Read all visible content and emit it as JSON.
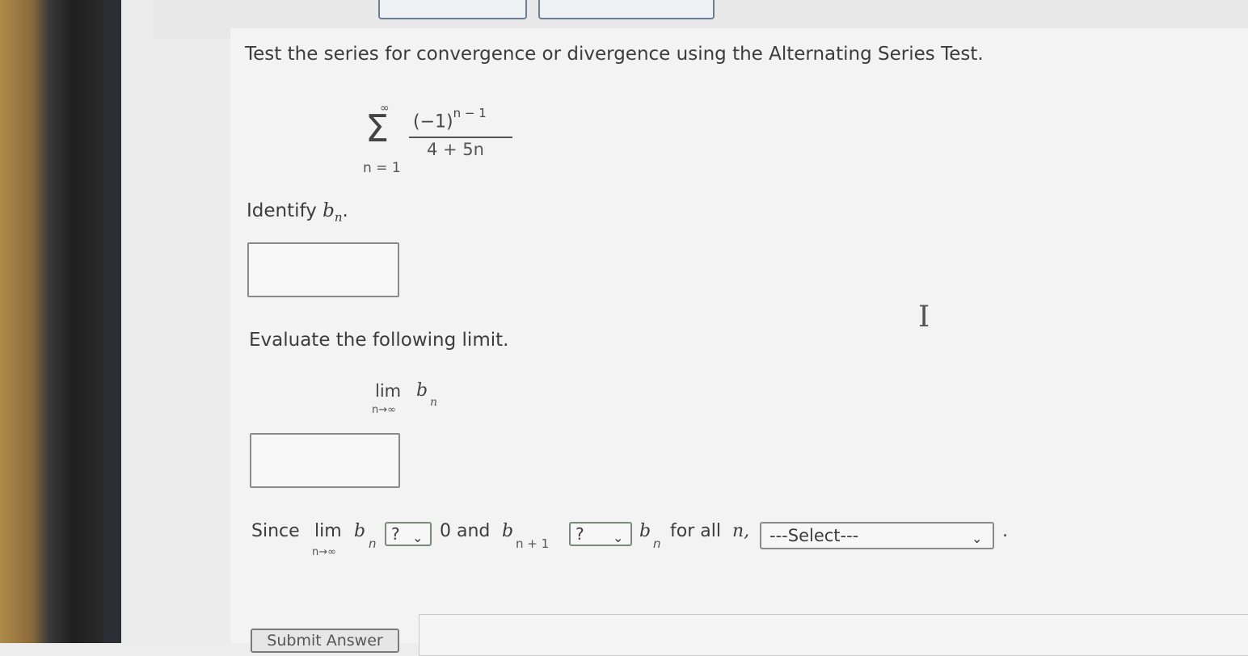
{
  "question": {
    "prompt": "Test the series for convergence or divergence using the Alternating Series Test."
  },
  "series": {
    "sum_symbol": "Σ",
    "upper": "∞",
    "lower": "n = 1",
    "numerator_base": "(−1)",
    "numerator_exponent": "n − 1",
    "denominator": "4 + 5n"
  },
  "identify": {
    "label": "Identify",
    "var": "b",
    "sub": "n",
    "end": ".",
    "value": ""
  },
  "limit": {
    "prompt": "Evaluate the following limit.",
    "lim": "lim",
    "lim_sub": "n→∞",
    "var": "b",
    "sub": "n",
    "value": ""
  },
  "since": {
    "since_word": "Since",
    "lim": "lim",
    "lim_sub": "n→∞",
    "b": "b",
    "n": "n",
    "select1_value": "?",
    "zero_and": "0 and",
    "b2": "b",
    "n_plus_1": "n + 1",
    "select2_value": "?",
    "b3": "b",
    "n3": "n",
    "for_all": "for all",
    "n_var": "n,",
    "conclusion_value": "---Select---",
    "period": "."
  },
  "buttons": {
    "submit": "Submit Answer"
  }
}
